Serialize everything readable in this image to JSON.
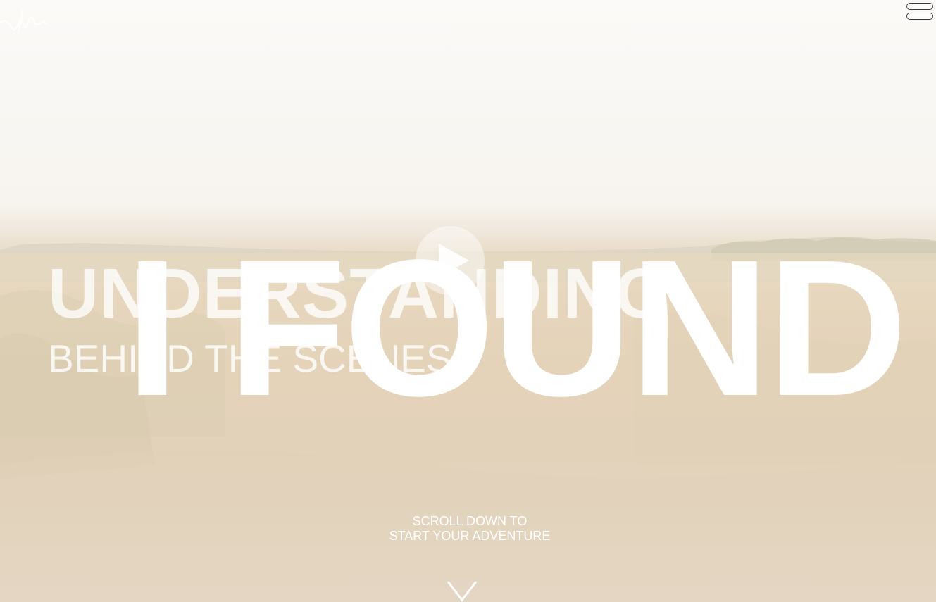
{
  "hero": {
    "background_title": "UNDERSTANDING",
    "background_subtitle": "BEHIND THE SCENES",
    "main_title": "I FOUND"
  },
  "scroll_prompt": {
    "line1": "SCROLL DOWN TO",
    "line2": "START YOUR ADVENTURE"
  },
  "icons": {
    "logo": "signature-logo-icon",
    "menu": "hamburger-menu-icon",
    "play": "play-icon",
    "scroll": "chevron-down-icon"
  },
  "colors": {
    "text": "#ffffff",
    "sky": "#f9f7f3",
    "grass": "#e4d3b9"
  }
}
